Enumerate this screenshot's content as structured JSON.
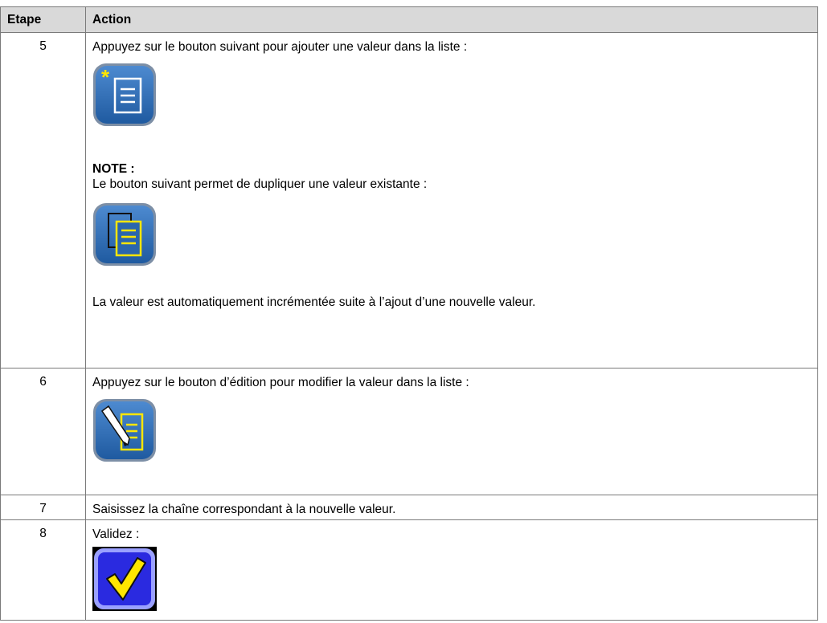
{
  "table": {
    "headers": {
      "step": "Etape",
      "action": "Action"
    },
    "rows": [
      {
        "step": "5",
        "text": "Appuyez sur le bouton suivant pour ajouter une valeur dans la liste :",
        "icon": "add-value-icon",
        "note_title": "NOTE :",
        "note_text": "Le bouton suivant permet de dupliquer une valeur existante :",
        "note_icon": "duplicate-value-icon",
        "after_text": "La valeur est automatiquement incrémentée suite à l’ajout d’une nouvelle valeur."
      },
      {
        "step": "6",
        "text": "Appuyez sur le bouton d’édition pour modifier la valeur dans la liste :",
        "icon": "edit-value-icon"
      },
      {
        "step": "7",
        "text": "Saisissez la chaîne correspondant à la nouvelle valeur."
      },
      {
        "step": "8",
        "text": "Validez :",
        "icon": "validate-check-icon"
      }
    ]
  },
  "colors": {
    "header_bg": "#d9d9d9",
    "icon_blue": "#2e6eb5",
    "icon_yellow": "#ffe600",
    "validate_bg": "#2a2ae0"
  }
}
